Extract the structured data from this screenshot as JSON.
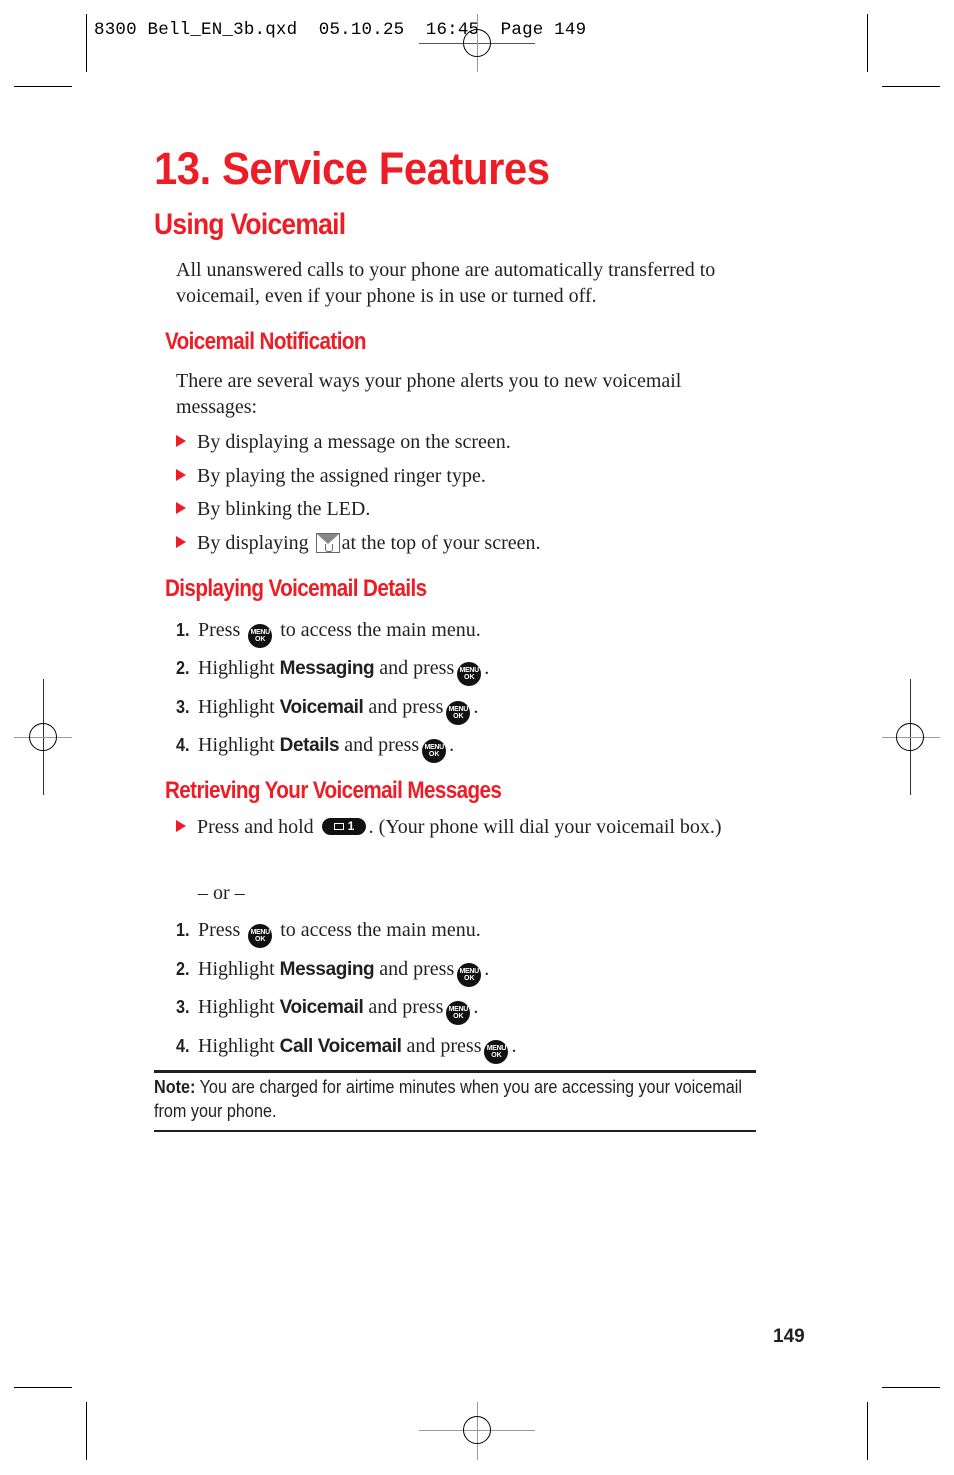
{
  "slug": {
    "text": "8300 Bell_EN_3b.qxd  05.10.25  16:45  Page 149"
  },
  "colors": {
    "heading_red": "#ee1c25",
    "text": "#231f20"
  },
  "chapter_title": "13. Service Features",
  "section_title": "Using Voicemail",
  "intro": "All unanswered calls to your phone are automatically transferred to voicemail, even if your phone is in use or turned off.",
  "notification": {
    "heading": "Voicemail Notification",
    "intro": "There are several ways your phone alerts you to new voicemail messages:",
    "bullets": [
      "By displaying a message on the screen.",
      "By playing the assigned ringer type.",
      "By blinking the LED.",
      {
        "before": "By displaying",
        "icon": "voicemail-envelope-icon",
        "after": "at the top of your screen."
      }
    ]
  },
  "details": {
    "heading": "Displaying Voicemail Details",
    "steps": [
      {
        "num": "1.",
        "before": "Press",
        "bold": "",
        "after": "to access the main menu."
      },
      {
        "num": "2.",
        "before": "Highlight",
        "bold": "Messaging",
        "after": "and press"
      },
      {
        "num": "3.",
        "before": "Highlight",
        "bold": "Voicemail",
        "after": "and press"
      },
      {
        "num": "4.",
        "before": "Highlight",
        "bold": "Details",
        "after": "and press"
      }
    ]
  },
  "retrieving": {
    "heading": "Retrieving Your Voicemail Messages",
    "bullet_before": "Press and hold",
    "bullet_key": "1",
    "bullet_after": ". (Your phone will dial your voicemail box.)",
    "or_text": "– or –",
    "steps": [
      {
        "num": "1.",
        "before": "Press",
        "bold": "",
        "after": "to access the main menu."
      },
      {
        "num": "2.",
        "before": "Highlight",
        "bold": "Messaging",
        "after": "and press"
      },
      {
        "num": "3.",
        "before": "Highlight",
        "bold": "Voicemail",
        "after": "and press"
      },
      {
        "num": "4.",
        "before": "Highlight",
        "bold": "Call Voicemail",
        "after": "and press"
      }
    ]
  },
  "menu_key": {
    "line1": "MENU",
    "line2": "OK"
  },
  "note": {
    "label": "Note:",
    "text": "You are charged for airtime minutes when you are accessing your voicemail from your phone."
  },
  "page_number": "149"
}
